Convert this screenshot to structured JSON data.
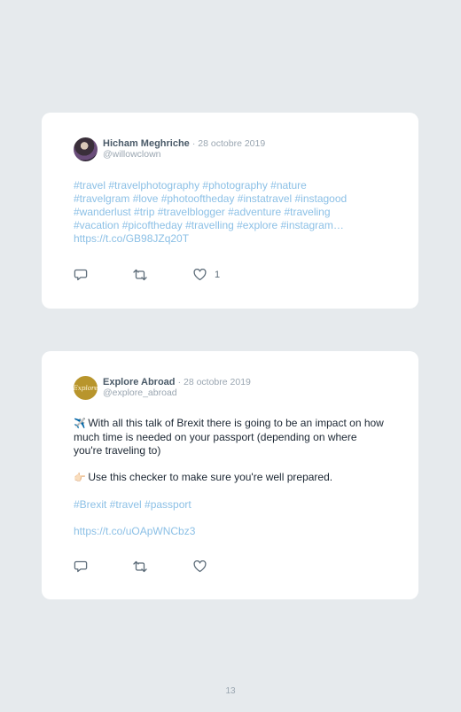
{
  "tweets": [
    {
      "author": "Hicham Meghriche",
      "date": "· 28 octobre 2019",
      "handle": "@willowclown",
      "hashtag_lines": [
        "#travel #travelphotography #photography #nature",
        "#travelgram #love #photooftheday #instatravel #instagood",
        "#wanderlust #trip #travelblogger #adventure #traveling",
        "#vacation #picoftheday #travelling #explore #instagram…"
      ],
      "link": "https://t.co/GB98JZq20T",
      "like_count": "1",
      "icons": [
        "reply-icon",
        "retweet-icon",
        "heart-icon"
      ]
    },
    {
      "author": "Explore Abroad",
      "date": "· 28 octobre 2019",
      "handle": "@explore_abroad",
      "avatar_text": "Explore",
      "emoji_1": "✈️",
      "text_1": "With all this talk of Brexit there is going to be an impact on how much time is needed on your passport (depending on where you're traveling to)",
      "emoji_2": "👉🏻",
      "text_2": "Use this checker to make sure you're well prepared.",
      "hashtags": "#Brexit #travel #passport",
      "link": "https://t.co/uOApWNCbz3",
      "icons": [
        "reply-icon",
        "retweet-icon",
        "heart-icon"
      ]
    }
  ],
  "page_number": "13",
  "colors": {
    "background": "#e6eaed",
    "card": "#ffffff",
    "link": "#8cc0e6",
    "muted": "#9aa6b1",
    "name": "#4a5a68"
  }
}
